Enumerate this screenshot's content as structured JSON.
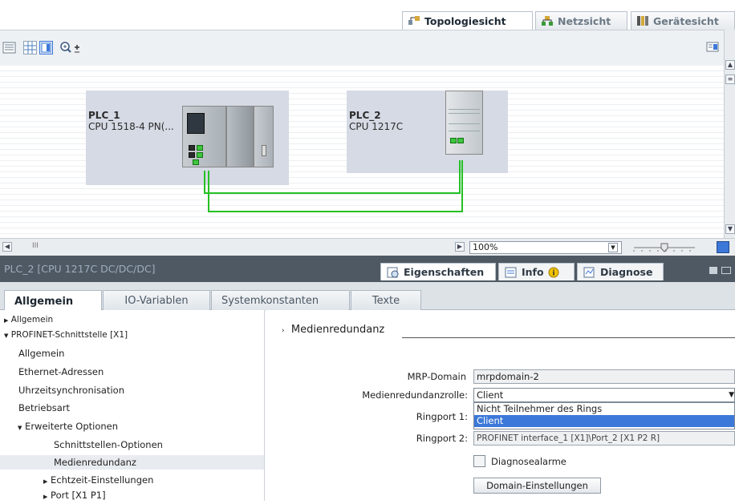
{
  "view_tabs": [
    {
      "label": "Topologiesicht",
      "active": true
    },
    {
      "label": "Netzsicht",
      "active": false
    },
    {
      "label": "Gerätesicht",
      "active": false
    }
  ],
  "devices": [
    {
      "name": "PLC_1",
      "type": "CPU 1518-4 PN(..."
    },
    {
      "name": "PLC_2",
      "type": "CPU 1217C"
    }
  ],
  "zoom": "100%",
  "hscroll_marker": "III",
  "inspector": {
    "title": "PLC_2 [CPU 1217C DC/DC/DC]",
    "tabs": [
      "Eigenschaften",
      "Info",
      "Diagnose"
    ]
  },
  "subtabs": [
    "Allgemein",
    "IO-Variablen",
    "Systemkonstanten",
    "Texte"
  ],
  "tree": [
    {
      "label": "Allgemein",
      "level": 0,
      "arrow": "right"
    },
    {
      "label": "PROFINET-Schnittstelle [X1]",
      "level": 0,
      "arrow": "down"
    },
    {
      "label": "Allgemein",
      "level": 1,
      "arrow": ""
    },
    {
      "label": "Ethernet-Adressen",
      "level": 1,
      "arrow": ""
    },
    {
      "label": "Uhrzeitsynchronisation",
      "level": 1,
      "arrow": ""
    },
    {
      "label": "Betriebsart",
      "level": 1,
      "arrow": ""
    },
    {
      "label": "Erweiterte Optionen",
      "level": 1,
      "arrow": "down"
    },
    {
      "label": "Schnittstellen-Optionen",
      "level": 2,
      "arrow": ""
    },
    {
      "label": "Medienredundanz",
      "level": 2,
      "arrow": "",
      "selected": true
    },
    {
      "label": "Echtzeit-Einstellungen",
      "level": 2,
      "arrow": "right"
    },
    {
      "label": "Port [X1 P1]",
      "level": 2,
      "arrow": "right"
    }
  ],
  "section": {
    "title": "Medienredundanz"
  },
  "form": {
    "mrp_label": "MRP-Domain",
    "mrp_value": "mrpdomain-2",
    "role_label": "Medienredundanzrolle:",
    "role_value": "Client",
    "role_options": [
      "Nicht Teilnehmer des Rings",
      "Client"
    ],
    "ring1_label": "Ringport 1:",
    "ring2_label": "Ringport 2:",
    "ring2_value": "PROFINET interface_1 [X1]\\Port_2 [X1 P2 R]",
    "diag_label": "Diagnosealarme",
    "domain_button": "Domain-Einstellungen"
  },
  "colors": {
    "accent": "#3c78d8",
    "header": "#4f5963",
    "wire": "#25c025"
  }
}
